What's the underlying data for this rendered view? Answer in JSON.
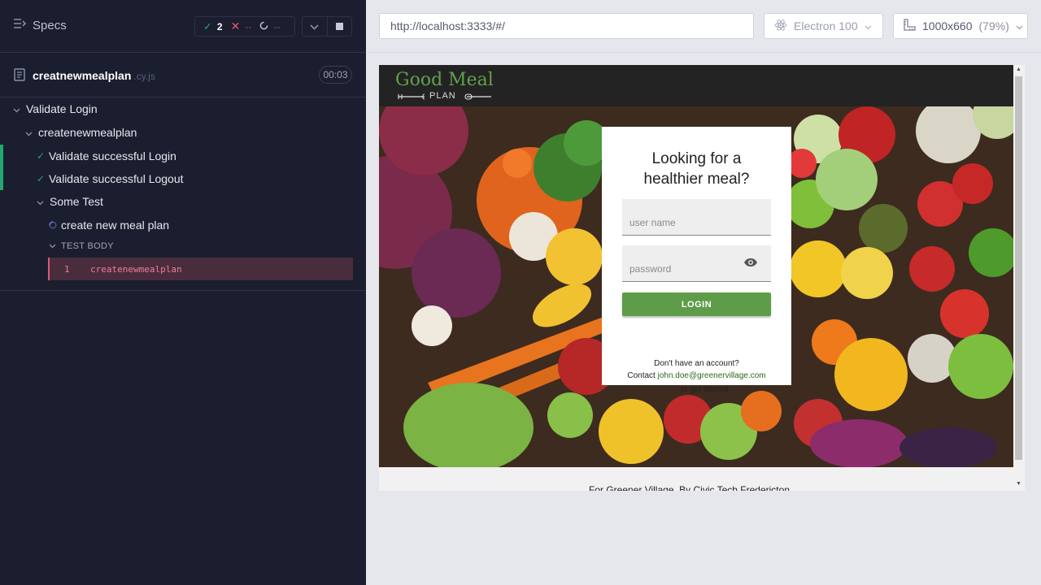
{
  "sidebar": {
    "specs_label": "Specs",
    "stats": {
      "passed": "2",
      "failed": "--",
      "pending": "--"
    },
    "spec_file": {
      "name": "creatnewmealplan",
      "ext": ".cy.js",
      "duration": "00:03"
    },
    "tree": {
      "suite": "Validate Login",
      "subsuite": "createnewmealplan",
      "tests": [
        "Validate successful Login",
        "Validate successful Logout"
      ],
      "nested_suite": "Some Test",
      "running_test": "create new meal plan",
      "test_body_label": "TEST BODY",
      "command": {
        "index": "1",
        "name": "createnewmealplan"
      }
    }
  },
  "browser": {
    "url": "http://localhost:3333/#/",
    "browser_name": "Electron 100",
    "viewport": "1000x660",
    "zoom": "(79%)"
  },
  "app": {
    "logo": {
      "title": "Good Meal",
      "sub": "PLAN"
    },
    "card": {
      "title_line1": "Looking for a",
      "title_line2": "healthier meal?",
      "username_placeholder": "user name",
      "password_placeholder": "password",
      "login_label": "LOGIN",
      "no_account": "Don't have an account?",
      "contact_prefix": "Contact ",
      "contact_email": "john.doe@greenervillage.com",
      "get_started": "to get started"
    },
    "footer": "For Greener Village, By Civic Tech Fredericton"
  },
  "colors": {
    "sidebar_bg": "#1b1e2e",
    "pass_green": "#1fa971",
    "fail_red": "#e45770",
    "brand_green": "#5f9c49",
    "command_bg": "#4a2d3d"
  }
}
